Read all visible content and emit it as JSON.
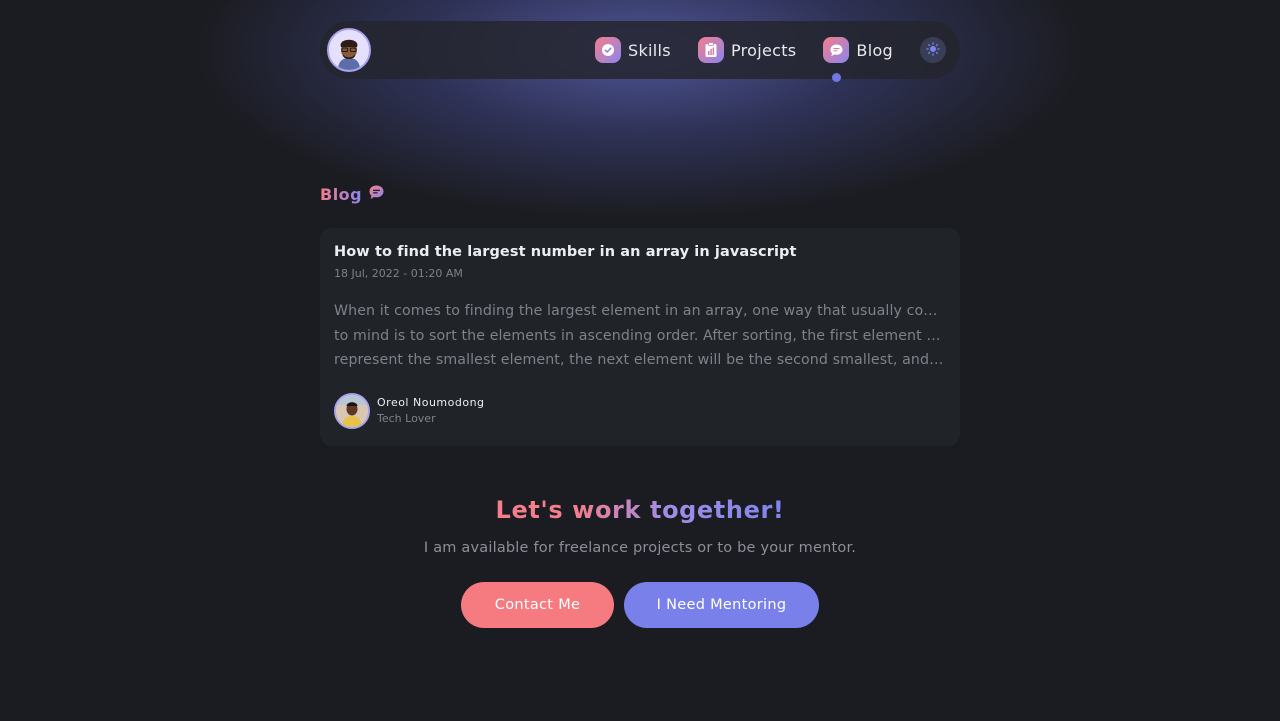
{
  "nav": {
    "items": [
      {
        "label": "Skills",
        "icon": "badge-check-icon"
      },
      {
        "label": "Projects",
        "icon": "clipboard-chart-icon"
      },
      {
        "label": "Blog",
        "icon": "chat-bubble-icon",
        "active": true
      }
    ],
    "theme_icon": "sun-icon"
  },
  "section": {
    "title": "Blog",
    "icon": "chat-bubble-icon"
  },
  "post": {
    "title": "How to find the largest number in an array in javascript",
    "date": "18 Jul, 2022 - 01:20 AM",
    "excerpt_lines": [
      "When it comes to finding the largest element in an array, one way that usually comes",
      "to mind is to sort the elements in ascending order. After sorting, the first element will",
      "represent the smallest element, the next element will be the second smallest, and s..."
    ],
    "author": {
      "name": "Oreol Noumodong",
      "role": "Tech Lover"
    }
  },
  "cta": {
    "title": "Let's work together!",
    "subtitle": "I am available for freelance projects or to be your mentor.",
    "contact_label": "Contact Me",
    "mentor_label": "I Need Mentoring"
  },
  "colors": {
    "background": "#1b1c21",
    "card": "#202327",
    "accent_pink": "#f67b80",
    "accent_blue": "#7980ea"
  }
}
